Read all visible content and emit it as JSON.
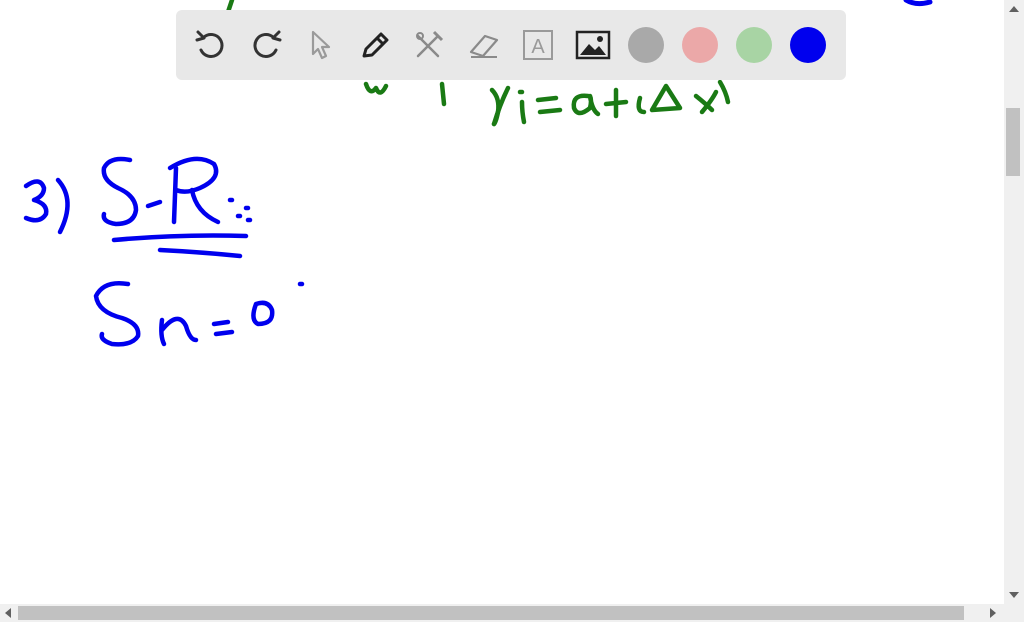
{
  "colors": {
    "blue_ink": "#0000ee",
    "green_ink": "#1a7a14",
    "toolbar_bg": "#e8e8e8"
  },
  "toolbar": {
    "tools": [
      {
        "name": "undo-icon"
      },
      {
        "name": "redo-icon"
      },
      {
        "name": "pointer-icon"
      },
      {
        "name": "pen-icon"
      },
      {
        "name": "tools-icon"
      },
      {
        "name": "eraser-icon"
      },
      {
        "name": "text-icon",
        "glyph": "A"
      },
      {
        "name": "image-icon"
      }
    ],
    "swatches": [
      {
        "name": "gray",
        "color": "#a9a9a9"
      },
      {
        "name": "pink",
        "color": "#eba8a8"
      },
      {
        "name": "light-green",
        "color": "#a8d4a4"
      },
      {
        "name": "blue",
        "color": "#0000ee"
      }
    ]
  }
}
